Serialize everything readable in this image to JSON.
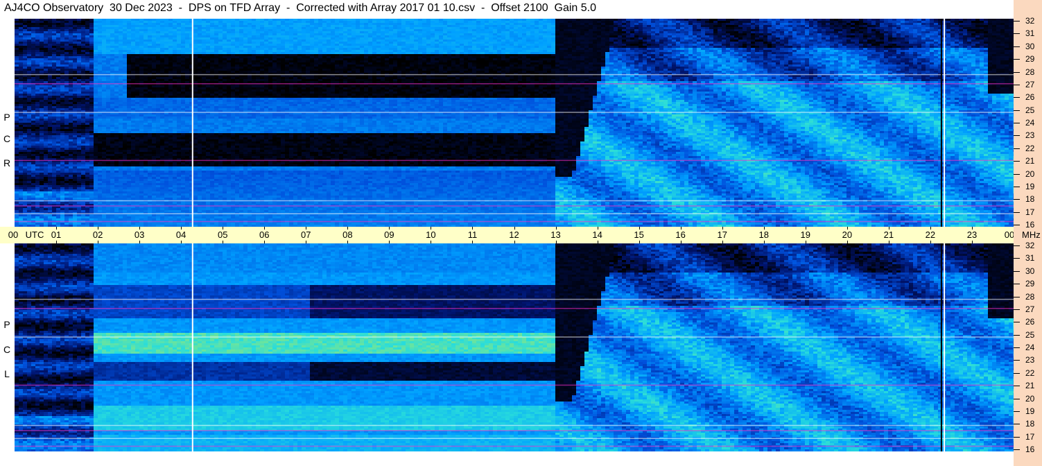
{
  "title": "AJ4CO Observatory  30 Dec 2023  -  DPS on TFD Array  -  Corrected with Array 2017 01 10.csv  -  Offset 2100  Gain 5.0",
  "chart_data": {
    "type": "heatmap",
    "title": "AJ4CO Observatory  30 Dec 2023  -  DPS on TFD Array  -  Corrected with Array 2017 01 10.csv  -  Offset 2100  Gain 5.0",
    "panels": [
      {
        "name": "RCP",
        "label_letters": [
          "P",
          "C",
          "R"
        ]
      },
      {
        "name": "LCP",
        "label_letters": [
          "P",
          "C",
          "L"
        ]
      }
    ],
    "x_axis": {
      "unit_label": "UTC",
      "ticks": [
        "00",
        "01",
        "02",
        "03",
        "04",
        "05",
        "06",
        "07",
        "08",
        "09",
        "10",
        "11",
        "12",
        "13",
        "14",
        "15",
        "16",
        "17",
        "18",
        "19",
        "20",
        "21",
        "22",
        "23",
        "00"
      ],
      "range": [
        0,
        24
      ]
    },
    "y_axis": {
      "unit_label": "MHz",
      "ticks": [
        "32",
        "31",
        "30",
        "29",
        "28",
        "27",
        "26",
        "25",
        "24",
        "23",
        "22",
        "21",
        "20",
        "19",
        "18",
        "17",
        "16"
      ],
      "range": [
        16,
        32
      ]
    },
    "colormap": [
      "#000000",
      "#00146e",
      "#0050dc",
      "#00a0ff",
      "#28dcdc",
      "#c8f046",
      "#ffffff",
      "#ff2dc8"
    ],
    "grid": false
  }
}
